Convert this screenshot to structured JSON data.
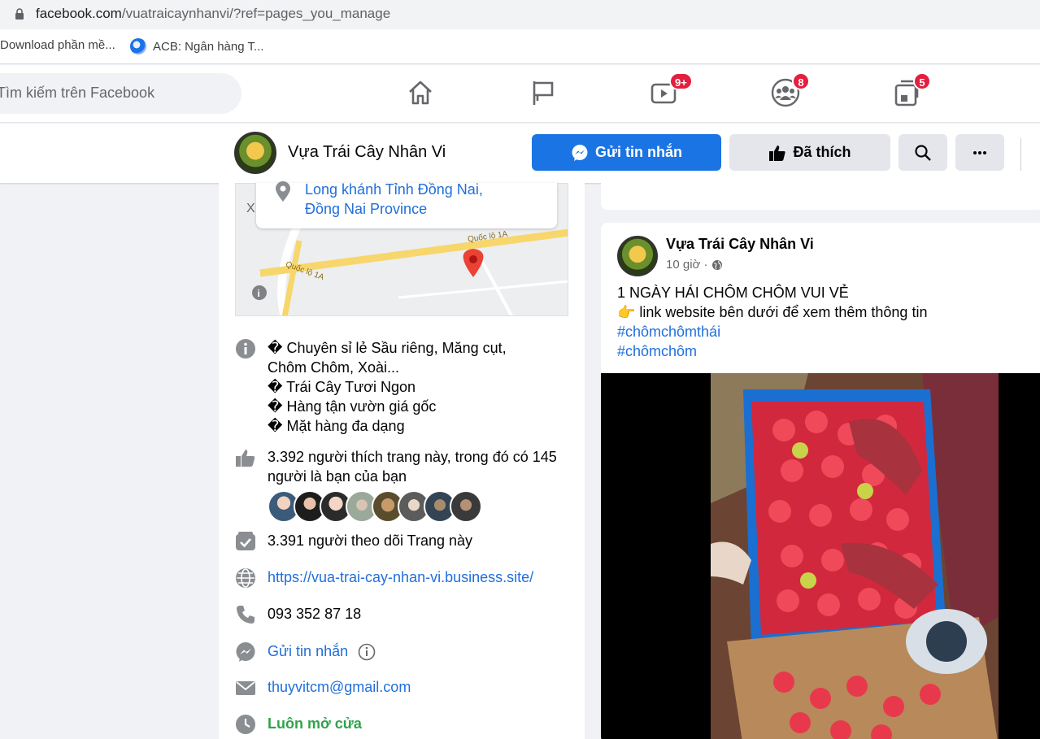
{
  "browser": {
    "url_host": "facebook.com",
    "url_path": "/vuatraicaynhanvi/?ref=pages_you_manage",
    "bookmarks": [
      {
        "label": "Download phần mề..."
      },
      {
        "label": "ACB: Ngân hàng T..."
      }
    ]
  },
  "fb_nav": {
    "search_placeholder": "Tìm kiếm trên Facebook",
    "icons": [
      "home-icon",
      "flag-icon",
      "watch-icon",
      "groups-icon",
      "gaming-icon"
    ],
    "badges": {
      "watch": "9+",
      "groups": "8",
      "gaming": "5"
    }
  },
  "page_header": {
    "name": "Vựa Trái Cây Nhân Vi",
    "message_button": "Gửi tin nhắn",
    "liked_button": "Đã thích"
  },
  "about": {
    "address_line1": "Long khánh Tỉnh Đồng Nai,",
    "address_line2": "Đồng Nai Province",
    "map_road_label": "Quốc lộ 1A",
    "map_x": "X",
    "description": [
      "� Chuyên sỉ lẻ Sầu riêng, Măng cụt,",
      "Chôm Chôm, Xoài...",
      "� Trái Cây Tươi Ngon",
      "� Hàng tận vườn giá gốc",
      "� Mặt hàng đa dạng"
    ],
    "likes_line1": "3.392 người thích trang này, trong đó có 145",
    "likes_line2": "người là bạn của bạn",
    "followers": "3.391 người theo dõi Trang này",
    "website": "https://vua-trai-cay-nhan-vi.business.site/",
    "phone": "093 352 87 18",
    "messenger": "Gửi tin nhắn",
    "email": "thuyvitcm@gmail.com",
    "hours": "Luôn mở cửa"
  },
  "post": {
    "author": "Vựa Trái Cây Nhân Vi",
    "time": "10 giờ ·",
    "line1": "1 NGÀY HÁI CHÔM CHÔM VUI VẺ",
    "line2": "👉 link website bên dưới để xem thêm thông tin",
    "hashtag1": "#chômchômthái",
    "hashtag2": "#chômchôm"
  },
  "colors": {
    "primary": "#1b74e4",
    "link": "#216fdb",
    "badge": "#e41e3f",
    "open_green": "#31a24c"
  }
}
